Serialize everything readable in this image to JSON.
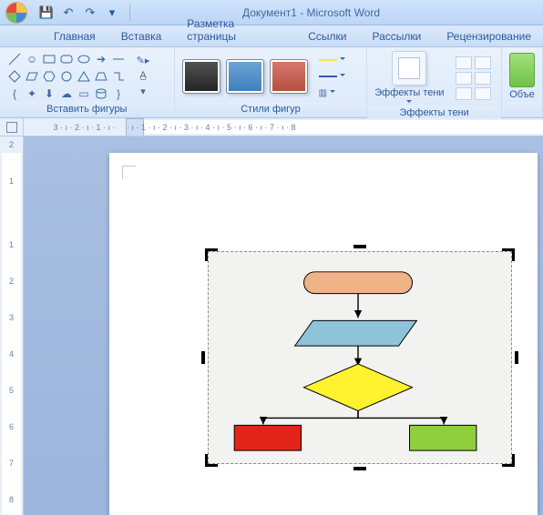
{
  "title": "Документ1 - Microsoft Word",
  "tabs": {
    "home": "Главная",
    "insert": "Вставка",
    "layout": "Разметка страницы",
    "refs": "Ссылки",
    "mail": "Рассылки",
    "review": "Рецензирование"
  },
  "ribbon": {
    "insert_shapes": "Вставить фигуры",
    "shape_styles": "Стили фигур",
    "shadow_effects_btn": "Эффекты тени",
    "shadow_effects_group": "Эффекты тени",
    "object_btn": "Объе"
  },
  "ruler": {
    "h": " 3 · ı · 2 · ı · 1 · ı ·     · ı · 1 · ı · 2 · ı · 3 · ı · 4 · ı · 5 · ı · 6 · ı · 7 · ı · 8",
    "v": [
      "2",
      "1",
      "",
      "1",
      "2",
      "3",
      "4",
      "5",
      "6",
      "7",
      "8"
    ]
  },
  "flowchart": {
    "shapes": {
      "terminator": {
        "fill": "#f0b388"
      },
      "data": {
        "fill": "#8fc3d9"
      },
      "decision": {
        "fill": "#fff22e"
      },
      "process_l": {
        "fill": "#e22418"
      },
      "process_r": {
        "fill": "#8fce3d"
      }
    }
  }
}
